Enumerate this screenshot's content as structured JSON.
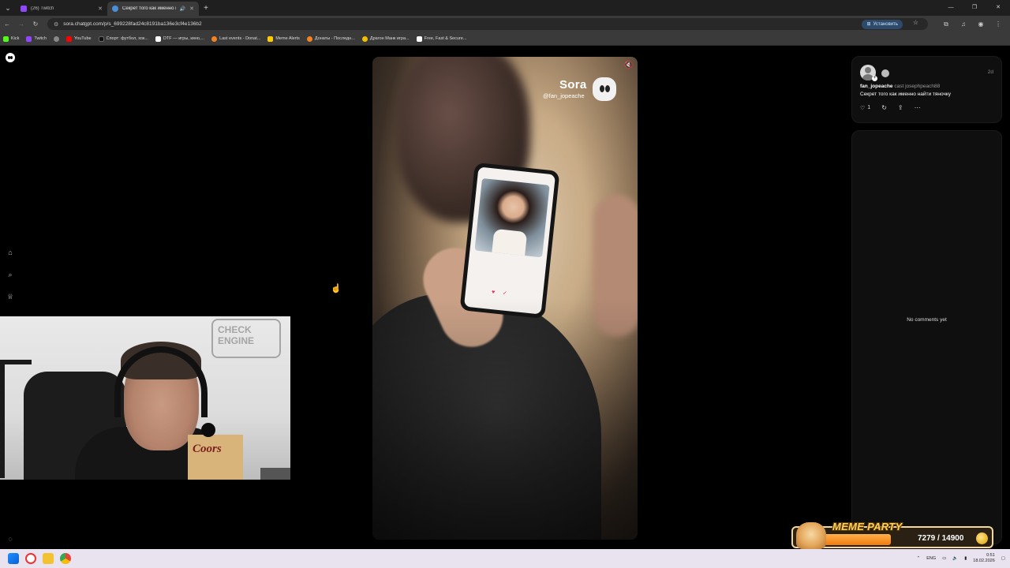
{
  "browser": {
    "tabs": [
      {
        "title": "(26) Twitch",
        "active": false,
        "color": "#9146ff"
      },
      {
        "title": "Секрет того как именно н",
        "active": true,
        "color": "#4a90d9"
      }
    ],
    "url": "sora.chatgpt.com/p/s_699228fad24c8191ba136e3cf4e136b2",
    "install_label": "Установить",
    "bookmarks": [
      {
        "label": "Kick",
        "color": "#53fc18"
      },
      {
        "label": "Twitch",
        "color": "#9146ff"
      },
      {
        "label": "",
        "color": "#888888"
      },
      {
        "label": "YouTube",
        "color": "#ff0000"
      },
      {
        "label": "Спорт: футбол, хок...",
        "color": "#111111"
      },
      {
        "label": "DTF — игры, кино,...",
        "color": "#ffffff"
      },
      {
        "label": "Last events - Donat...",
        "color": "#f58220"
      },
      {
        "label": "Meme Alerts",
        "color": "#ffcc00"
      },
      {
        "label": "Донаты - Последн...",
        "color": "#f58220"
      },
      {
        "label": "Драгон Манк игра...",
        "color": "#f2c000"
      },
      {
        "label": "Free, Fast & Secure...",
        "color": "#ffffff"
      }
    ]
  },
  "video": {
    "watermark_title": "Sora",
    "watermark_handle": "@fan_jopeache"
  },
  "post": {
    "username": "fan_jopeache",
    "cast_text": "cast josephpeach88",
    "caption": "Секрет того как именно найти тяночку",
    "time": "2d",
    "likes": "1"
  },
  "comments": {
    "empty_text": "No comments yet"
  },
  "webcam": {
    "sign_text": "CHECK ENGINE",
    "box_text": "Coors"
  },
  "meme_party": {
    "label": "MEME PARTY",
    "count": "7279 / 14900",
    "progress": 0.49
  },
  "taskbar": {
    "lang": "ENG",
    "time": "0:51",
    "date": "18.02.2026"
  }
}
